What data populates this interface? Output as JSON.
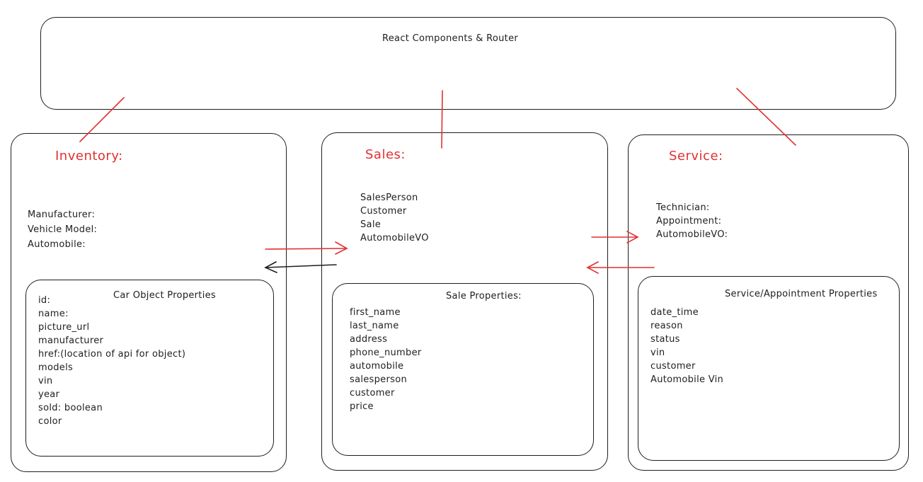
{
  "colors": {
    "stroke": "#1e1e1e",
    "accent": "#e03131"
  },
  "top_box": {
    "title": "React Components & Router"
  },
  "inventory": {
    "heading": "Inventory:",
    "models": [
      "Manufacturer:",
      "Vehicle Model:",
      "Automobile:"
    ],
    "properties_title": "Car Object Properties",
    "properties": [
      "id:",
      "name:",
      "picture_url",
      "manufacturer",
      "href:(location of api for object)",
      "models",
      "vin",
      "year",
      "sold: boolean",
      "color"
    ]
  },
  "sales": {
    "heading": "Sales:",
    "models": [
      "SalesPerson",
      "Customer",
      "Sale",
      "AutomobileVO"
    ],
    "properties_title": "Sale Properties:",
    "properties": [
      "first_name",
      "last_name",
      "address",
      "phone_number",
      "automobile",
      "salesperson",
      "customer",
      "price"
    ]
  },
  "service": {
    "heading": "Service:",
    "models": [
      "Technician:",
      "Appointment:",
      "AutomobileVO:"
    ],
    "properties_title": "Service/Appointment Properties",
    "properties": [
      "date_time",
      "reason",
      "status",
      "vin",
      "customer",
      "Automobile Vin"
    ]
  }
}
